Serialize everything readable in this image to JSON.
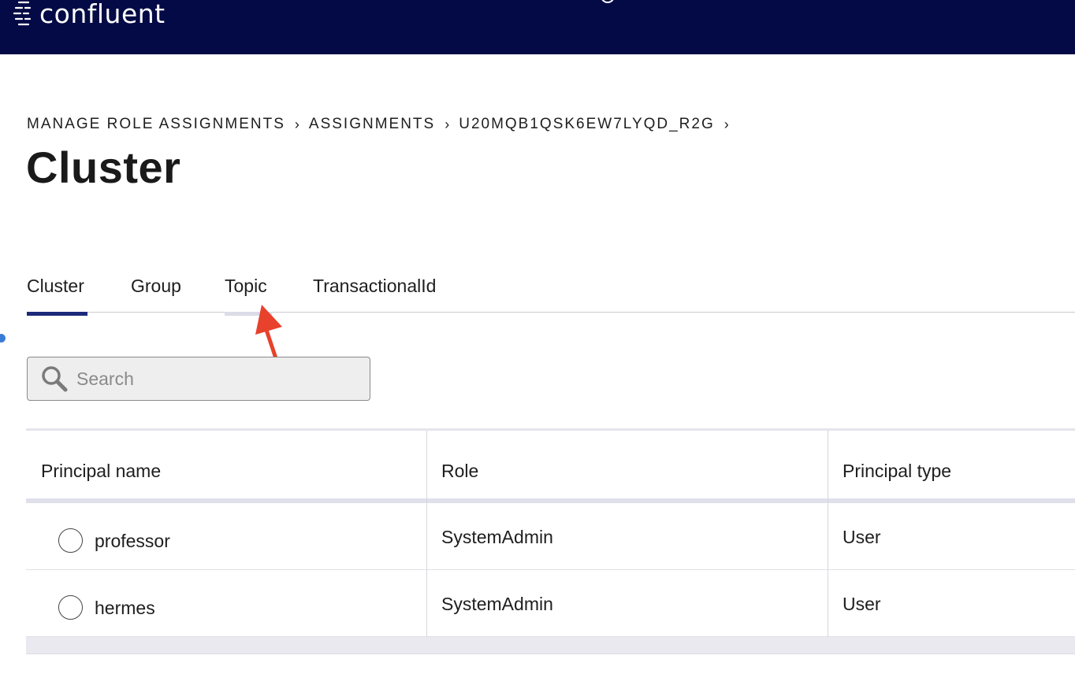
{
  "header": {
    "logo_text": "confluent"
  },
  "breadcrumb": {
    "items": [
      "MANAGE ROLE ASSIGNMENTS",
      "ASSIGNMENTS",
      "U20MQB1QSK6EW7LYQD_R2G"
    ],
    "separator": "›"
  },
  "page": {
    "title": "Cluster"
  },
  "tabs": [
    {
      "label": "Cluster",
      "active": true
    },
    {
      "label": "Group",
      "active": false
    },
    {
      "label": "Topic",
      "active": false
    },
    {
      "label": "TransactionalId",
      "active": false
    }
  ],
  "search": {
    "placeholder": "Search",
    "value": ""
  },
  "table": {
    "columns": [
      "Principal name",
      "Role",
      "Principal type"
    ],
    "rows": [
      {
        "name": "professor",
        "role": "SystemAdmin",
        "type": "User"
      },
      {
        "name": "hermes",
        "role": "SystemAdmin",
        "type": "User"
      }
    ]
  },
  "colors": {
    "topbar": "#040a45",
    "tab_indicator": "#1c2a7a",
    "annotation_arrow": "#e8412c"
  },
  "icons": {
    "logo": "confluent-logo-icon",
    "search": "search-icon",
    "annotation": "annotation-arrow-icon"
  }
}
